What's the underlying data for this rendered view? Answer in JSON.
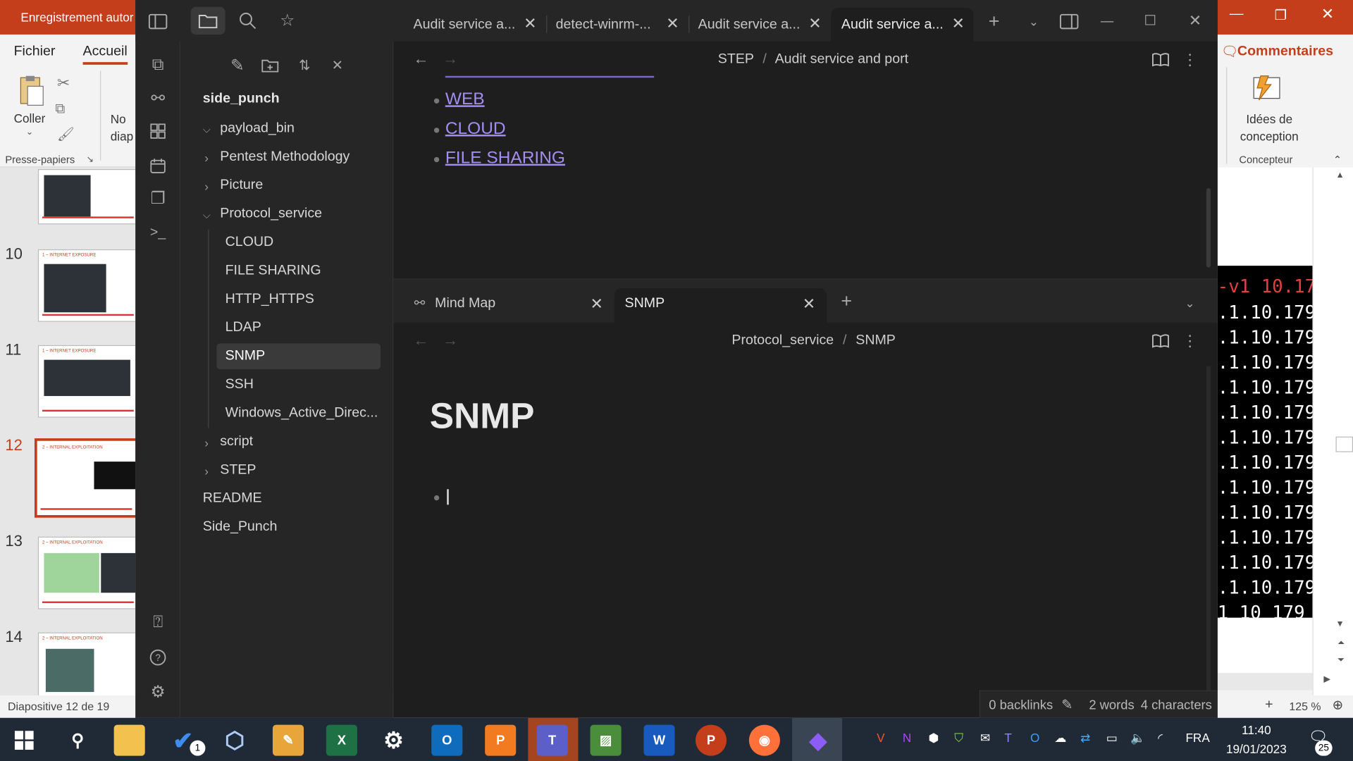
{
  "powerpoint": {
    "title": "Enregistrement autor",
    "tabs": {
      "file": "Fichier",
      "home": "Accueil"
    },
    "comments": "Commentaires",
    "ribbon": {
      "paste": "Coller",
      "new_slide": "No\ndiap",
      "clipboard_group": "Presse-papiers",
      "designer_label": "Idées de\nconception",
      "designer_group": "Concepteur"
    },
    "slides": [
      "10",
      "11",
      "12",
      "13",
      "14"
    ],
    "slide_headers": {
      "10": "1 – INTERNET EXPOSURE",
      "11": "1 – INTERNET EXPOSURE",
      "12": "2 – INTERNAL EXPLOITATION",
      "13": "2 – INTERNAL EXPLOITATION",
      "14": "2 – INTERNAL EXPLOITATION"
    },
    "status": "Diapositive 12 de 19",
    "zoom": "125 %",
    "terminal_lines": [
      "-v1 10.17",
      ".1.10.179.",
      ".1.10.179.",
      ".1.10.179.",
      ".1.10.179.",
      ".1.10.179.",
      ".1.10.179.",
      ".1.10.179.",
      ".1.10.179.",
      ".1.10.179.",
      ".1.10.179.",
      ".1.10.179.",
      ".1.10.179.",
      "1 10 179"
    ]
  },
  "obsidian": {
    "tabs": [
      "Audit service a...",
      "detect-winrm-...",
      "Audit service a...",
      "Audit service a..."
    ],
    "vault_name": "side_punch",
    "tree": {
      "payload_bin": "payload_bin",
      "pentest": "Pentest Methodology",
      "picture": "Picture",
      "protocol": "Protocol_service",
      "children": [
        "CLOUD",
        "FILE SHARING",
        "HTTP_HTTPS",
        "LDAP",
        "SNMP",
        "SSH",
        "Windows_Active_Direc..."
      ],
      "script": "script",
      "step": "STEP",
      "readme": "README",
      "side_punch": "Side_Punch"
    },
    "pane1": {
      "breadcrumb_parent": "STEP",
      "breadcrumb_sep": "/",
      "breadcrumb_current": "Audit service and port",
      "links": [
        "WEB",
        "CLOUD",
        "FILE SHARING"
      ]
    },
    "pane2": {
      "tabs": [
        "Mind Map",
        "SNMP"
      ],
      "breadcrumb_parent": "Protocol_service",
      "breadcrumb_sep": "/",
      "breadcrumb_current": "SNMP",
      "heading": "SNMP"
    },
    "status": {
      "backlinks": "0 backlinks",
      "words": "2 words",
      "characters": "4 characters"
    }
  },
  "taskbar": {
    "language": "FRA",
    "time": "11:40",
    "date": "19/01/2023",
    "notifications": "25",
    "badge_todo": "1"
  },
  "colors": {
    "ppt_accent": "#c43e1c",
    "obsidian_link": "#a48df0",
    "taskbar": "#1f2a36"
  }
}
